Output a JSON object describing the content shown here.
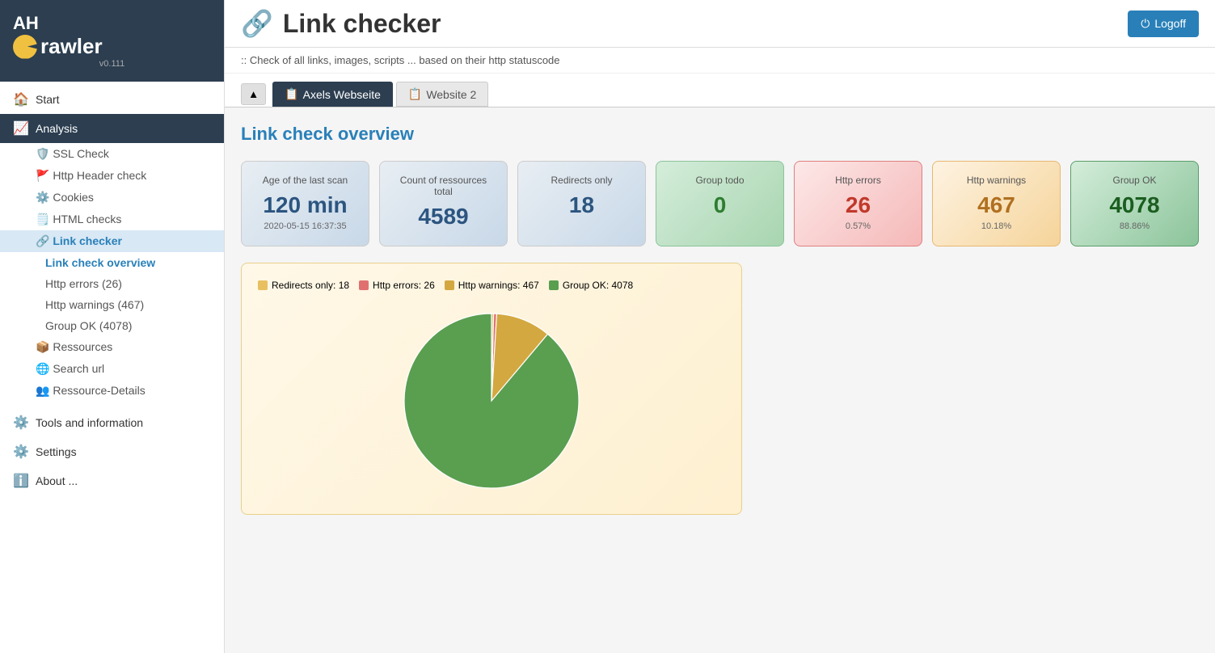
{
  "logo": {
    "initials": "AH",
    "crawler_text": "rawler",
    "version": "v0.111"
  },
  "logoff_label": "Logoff",
  "page_title": "Link checker",
  "subtitle": ":: Check of all links, images, scripts ... based on their http statuscode",
  "tabs": [
    {
      "label": "Axels Webseite",
      "active": true,
      "icon": "📋"
    },
    {
      "label": "Website 2",
      "active": false,
      "icon": "📋"
    }
  ],
  "section_title": "Link check overview",
  "stat_cards": [
    {
      "label": "Age of the last scan",
      "value": "120 min",
      "sub": "2020-05-15 16:37:35",
      "style": "gray"
    },
    {
      "label": "Count of ressources total",
      "value": "4589",
      "sub": "",
      "style": "gray"
    },
    {
      "label": "Redirects only",
      "value": "18",
      "sub": "",
      "style": "gray"
    },
    {
      "label": "Group todo",
      "value": "0",
      "sub": "",
      "style": "green-light"
    },
    {
      "label": "Http errors",
      "value": "26",
      "sub": "0.57%",
      "style": "red-light"
    },
    {
      "label": "Http warnings",
      "value": "467",
      "sub": "10.18%",
      "style": "orange-light"
    },
    {
      "label": "Group OK",
      "value": "4078",
      "sub": "88.86%",
      "style": "green-dark"
    }
  ],
  "chart": {
    "legend": [
      {
        "label": "Redirects only: 18",
        "color": "#e8c060"
      },
      {
        "label": "Http errors: 26",
        "color": "#e07070"
      },
      {
        "label": "Http warnings: 467",
        "color": "#d4a840"
      },
      {
        "label": "Group OK: 4078",
        "color": "#5a9e50"
      }
    ],
    "slices": [
      {
        "label": "Redirects only",
        "value": 18,
        "color": "#e8c060"
      },
      {
        "label": "Http errors",
        "value": 26,
        "color": "#e07070"
      },
      {
        "label": "Http warnings",
        "value": 467,
        "color": "#d4a840"
      },
      {
        "label": "Group OK",
        "value": 4078,
        "color": "#5a9e50"
      }
    ],
    "total": 4589
  },
  "nav": {
    "start_label": "Start",
    "analysis_label": "Analysis",
    "ssl_check_label": "SSL Check",
    "http_header_label": "Http Header check",
    "cookies_label": "Cookies",
    "html_checks_label": "HTML checks",
    "link_checker_label": "Link checker",
    "link_check_overview_label": "Link check overview",
    "http_errors_label": "Http errors (26)",
    "http_warnings_label": "Http warnings (467)",
    "group_ok_label": "Group OK (4078)",
    "ressources_label": "Ressources",
    "search_url_label": "Search url",
    "ressource_details_label": "Ressource-Details",
    "tools_label": "Tools and information",
    "settings_label": "Settings",
    "about_label": "About ..."
  }
}
